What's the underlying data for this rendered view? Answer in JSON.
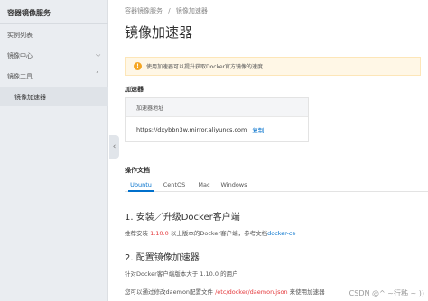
{
  "sidebar": {
    "title": "容器镜像服务",
    "items": [
      {
        "label": "实例列表"
      },
      {
        "label": "镜像中心"
      },
      {
        "label": "镜像工具"
      }
    ],
    "sub_item": "镜像加速器",
    "collapse_glyph": "‹"
  },
  "breadcrumb": {
    "items": [
      "容器镜像服务",
      "/",
      "镜像加速器"
    ]
  },
  "page": {
    "title": "镜像加速器"
  },
  "notice": {
    "icon": "!",
    "text": "使用加速器可以提升获取Docker官方镜像的速度"
  },
  "accelerator": {
    "section_title": "加速器",
    "header": "加速器地址",
    "url": "https://dxybbn3w.mirror.aliyuncs.com",
    "copy_label": "复制"
  },
  "docs": {
    "section_title": "操作文档",
    "tabs": [
      "Ubuntu",
      "CentOS",
      "Mac",
      "Windows"
    ],
    "active_tab": "Ubuntu",
    "step1_title": "1. 安装／升级Docker客户端",
    "step1_text_a": "推荐安装 ",
    "step1_version": "1.10.0",
    "step1_text_b": " 以上版本的Docker客户端，参考文档",
    "step1_link": "docker-ce",
    "step2_title": "2. 配置镜像加速器",
    "step2_text": "针对Docker客户端版本大于 1.10.0 的用户",
    "step3_text_a": "您可以通过修改daemon配置文件 ",
    "step3_path": "/etc/docker/daemon.json",
    "step3_text_b": " 来使用加速器"
  },
  "watermark": "CSDN @^ ~行秭 ~ ))",
  "colors": {
    "accent": "#0070cc",
    "notice_bg": "#fff7e6",
    "notice_icon": "#f5a623",
    "highlight": "#e4393c",
    "sidebar_bg": "#eaedf1"
  }
}
